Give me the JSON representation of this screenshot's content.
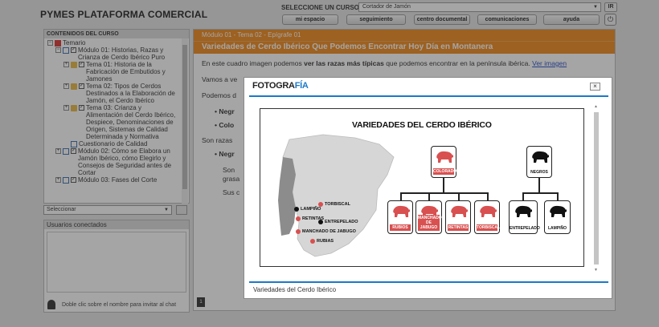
{
  "header": {
    "app_title": "PYMES PLATAFORMA COMERCIAL",
    "course_label": "SELECCIONE UN CURSO:",
    "course_value": "Cortador de Jamón",
    "ir_label": "IR",
    "nav": [
      "mi espacio",
      "seguimiento",
      "centro documental",
      "comunicaciones",
      "ayuda"
    ]
  },
  "sidebar": {
    "title": "CONTENIDOS DEL CURSO",
    "tree": [
      {
        "text": "Temario",
        "level": 0
      },
      {
        "text": "Módulo 01: Historias, Razas y Crianza de Cerdo Ibérico Puro",
        "level": 1
      },
      {
        "text": "Tema 01: Historia de la Fabricación de Embutidos y Jamones",
        "level": 2
      },
      {
        "text": "Tema 02: Tipos de Cerdos Destinados a la Elaboración de Jamón, el Cerdo Ibérico",
        "level": 2
      },
      {
        "text": "Tema 03: Crianza y Alimentación del Cerdo Ibérico, Despiece, Denominaciones de Origen, Sistemas de Calidad Determinada y Normativa",
        "level": 2
      },
      {
        "text": "Cuestionario de Calidad",
        "level": 2
      },
      {
        "text": "Módulo 02: Cómo se Elabora un Jamón Ibérico, cómo Elegirlo y Consejos de Seguridad antes de Cortar",
        "level": 1
      },
      {
        "text": "Módulo 03: Fases del Corte",
        "level": 1
      }
    ],
    "select_value": "Seleccionar"
  },
  "users": {
    "title": "Usuarios conectados",
    "hint": "Doble clic sobre el nombre para invitar al chat"
  },
  "content": {
    "breadcrumb": "Módulo 01 - Tema 02 - Epígrafe 01",
    "title": "Variedades de Cerdo Ibérico Que Podemos Encontrar Hoy Día en Montanera",
    "intro_pre": "En este cuadro imagen podemos ",
    "intro_bold": "ver las razas más típicas",
    "intro_post": " que podemos encontrar en la península ibérica. ",
    "intro_link": "Ver imagen",
    "frag1": "Vamos a ve",
    "frag2": "Podemos d",
    "frag3": "Negr",
    "frag4": "Colo",
    "frag5": "Son razas",
    "frag6": "Negr",
    "frag7": "Son",
    "frag8": "grasa",
    "frag9": "Sus c"
  },
  "modal": {
    "logo_main": "FOTOGRA",
    "logo_accent": "FÍA",
    "caption": "Variedades del Cerdo Ibérico",
    "figure": {
      "title": "VARIEDADES DEL CERDO IBÉRICO",
      "legend": [
        {
          "name": "TORBISCAL",
          "color": "red"
        },
        {
          "name": "LAMPIÑO",
          "color": "black"
        },
        {
          "name": "RETINTAS",
          "color": "red"
        },
        {
          "name": "ENTREPELADO",
          "color": "black"
        },
        {
          "name": "MANCHADO DE JABUGO",
          "color": "red"
        },
        {
          "name": "RUBIAS",
          "color": "red"
        }
      ],
      "colorados": "COLORADOS",
      "negros": "NEGROS",
      "colorados_children": [
        "RUBIOS",
        "MANCHADO DE JABUGO",
        "RETINTAS",
        "TORBISCAL"
      ],
      "negros_children": [
        "ENTREPELADO",
        "LAMPIÑO"
      ]
    }
  },
  "colors": {
    "accent_orange": "#f28a1c",
    "modal_blue": "#1a79c9",
    "pig_red": "#d85050"
  }
}
